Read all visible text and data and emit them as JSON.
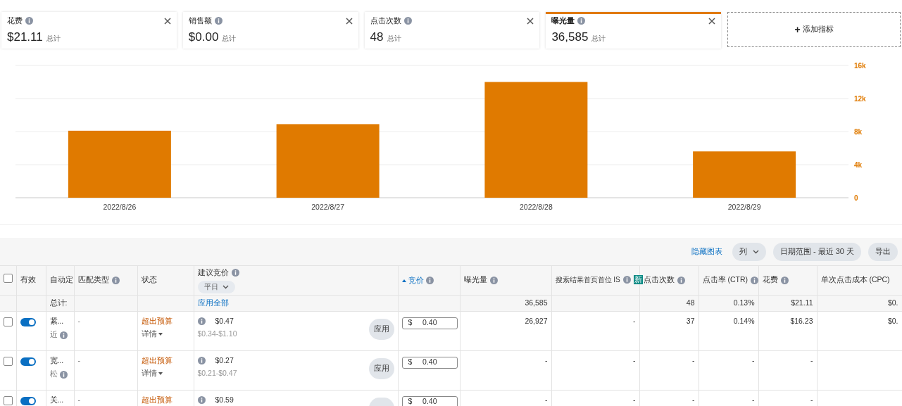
{
  "metrics": [
    {
      "label": "花费",
      "value": "$21.11",
      "suffix": "总计",
      "selected": false
    },
    {
      "label": "销售额",
      "value": "$0.00",
      "suffix": "总计",
      "selected": false
    },
    {
      "label": "点击次数",
      "value": "48",
      "suffix": "总计",
      "selected": false
    },
    {
      "label": "曝光量",
      "value": "36,585",
      "suffix": "总计",
      "selected": true
    }
  ],
  "add_metric": {
    "icon": "+",
    "label": "添加指标"
  },
  "chart": {
    "chart_data": {
      "type": "bar",
      "categories": [
        "2022/8/26",
        "2022/8/27",
        "2022/8/28",
        "2022/8/29"
      ],
      "series": [
        {
          "color": "#e07a00",
          "values": [
            8100,
            8900,
            14000,
            5600
          ]
        }
      ],
      "grid": true,
      "ylim": [
        0,
        16000
      ],
      "yticks": [
        {
          "value": 0,
          "label": "0"
        },
        {
          "value": 4000,
          "label": "4k"
        },
        {
          "value": 8000,
          "label": "8k"
        },
        {
          "value": 12000,
          "label": "12k"
        },
        {
          "value": 16000,
          "label": "16k"
        }
      ]
    }
  },
  "toolbar": {
    "hide_chart": "隐藏图表",
    "columns": "列",
    "date_range": "日期范围 - 最近 30 天",
    "export": "导出"
  },
  "table": {
    "columns": [
      {
        "kind": "checkbox",
        "checked": false
      },
      {
        "label": "有效",
        "kind": "text"
      },
      {
        "label": "自动定",
        "kind": "text"
      },
      {
        "label": "匹配类型",
        "kind": "info"
      },
      {
        "label": "状态",
        "kind": "text"
      },
      {
        "label": "建议竞价",
        "kind": "dropdown",
        "dropdown": "平日"
      },
      {
        "label": "竞价",
        "kind": "sorted"
      },
      {
        "label": "曝光量",
        "kind": "info"
      },
      {
        "label": "搜索结果首页首位 IS",
        "kind": "badge",
        "badge": "新"
      },
      {
        "label": "点击次数",
        "kind": "info"
      },
      {
        "label": "点击率 (CTR)",
        "kind": "info"
      },
      {
        "label": "花费",
        "kind": "info"
      },
      {
        "label": "单次点击成本 (CPC)",
        "kind": "text"
      }
    ],
    "totals": {
      "label": "总计:",
      "apply_all": "应用全部",
      "impressions": "36,585",
      "clicks": "48",
      "ctr": "0.13%",
      "spend": "$21.11",
      "cpc": "$0."
    },
    "rows": [
      {
        "checked": false,
        "on": true,
        "name": "紧...",
        "name_sub": "近",
        "match_type": "-",
        "status": "超出预算",
        "status_detail": "详情",
        "suggested_bid": "$0.47",
        "bid_range": "$0.34-$1.10",
        "apply": "应用",
        "currency": "$",
        "bid": "0.40",
        "impressions": "26,927",
        "is_share": "-",
        "clicks": "37",
        "ctr": "0.14%",
        "spend": "$16.23",
        "cpc": "$0."
      },
      {
        "checked": false,
        "on": true,
        "name": "宽...",
        "name_sub": "松",
        "match_type": "-",
        "status": "超出预算",
        "status_detail": "详情",
        "suggested_bid": "$0.27",
        "bid_range": "$0.21-$0.47",
        "apply": "应用",
        "currency": "$",
        "bid": "0.40",
        "impressions": "-",
        "is_share": "-",
        "clicks": "-",
        "ctr": "-",
        "spend": "-"
      },
      {
        "checked": false,
        "on": true,
        "name": "关...",
        "match_type": "-",
        "status": "超出预算",
        "suggested_bid": "$0.59",
        "currency": "$",
        "bid": "0.40",
        "impressions": "-",
        "is_share": "-",
        "clicks": "-",
        "ctr": "-",
        "spend": "-"
      }
    ]
  }
}
